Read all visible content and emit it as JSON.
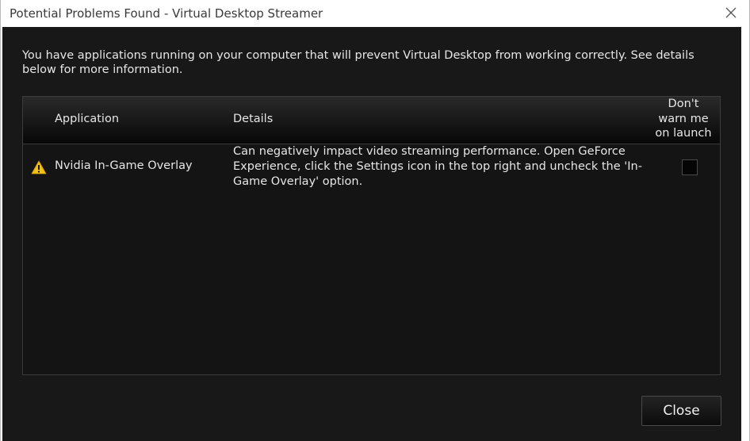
{
  "window": {
    "title": "Potential Problems Found - Virtual Desktop Streamer",
    "close_icon": "close-icon"
  },
  "message": "You have applications running on your computer that will prevent Virtual Desktop from working correctly. See details below for more information.",
  "table": {
    "columns": {
      "application": "Application",
      "details": "Details",
      "dont_warn_line1": "Don't",
      "dont_warn_line2": "warn me",
      "dont_warn_line3": "on launch"
    },
    "rows": [
      {
        "icon": "warning-icon",
        "application": "Nvidia In-Game Overlay",
        "details": "Can negatively impact video streaming performance. Open GeForce Experience, click the Settings icon in the top right and uncheck the 'In-Game Overlay' option.",
        "dont_warn_checked": false
      }
    ]
  },
  "buttons": {
    "close_label": "Close"
  },
  "colors": {
    "background": "#181818",
    "header_gradient_top": "#2a2a2a",
    "text": "#e6e6e6",
    "warning": "#f2c01d"
  }
}
